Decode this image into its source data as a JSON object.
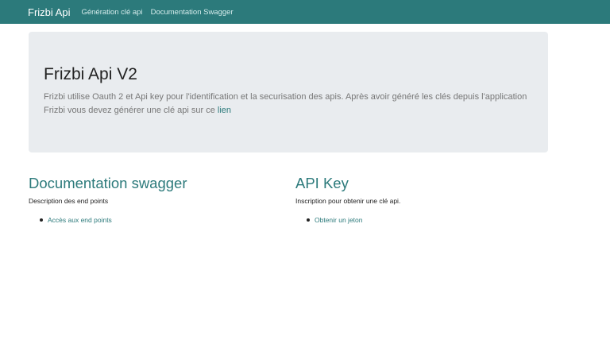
{
  "navbar": {
    "brand": "Frizbi Api",
    "links": [
      "Génération clé api",
      "Documentation Swagger"
    ]
  },
  "jumbotron": {
    "title": "Frizbi Api V2",
    "text": "Frizbi utilise Oauth 2 et Api key pour l'identification et la securisation des apis. Après avoir généré les clés depuis l'application Frizbi vous devez générer une clé api sur ce ",
    "link": "lien"
  },
  "sections": {
    "swagger": {
      "title": "Documentation swagger",
      "description": "Description des end points",
      "link": "Accès aux end points"
    },
    "apikey": {
      "title": "API Key",
      "description": "Inscription pour obtenir une clé api.",
      "link": "Obtenir un jeton"
    }
  },
  "colors": {
    "primary": "#2c7a7b",
    "jumbotron_bg": "#e9ecef"
  }
}
